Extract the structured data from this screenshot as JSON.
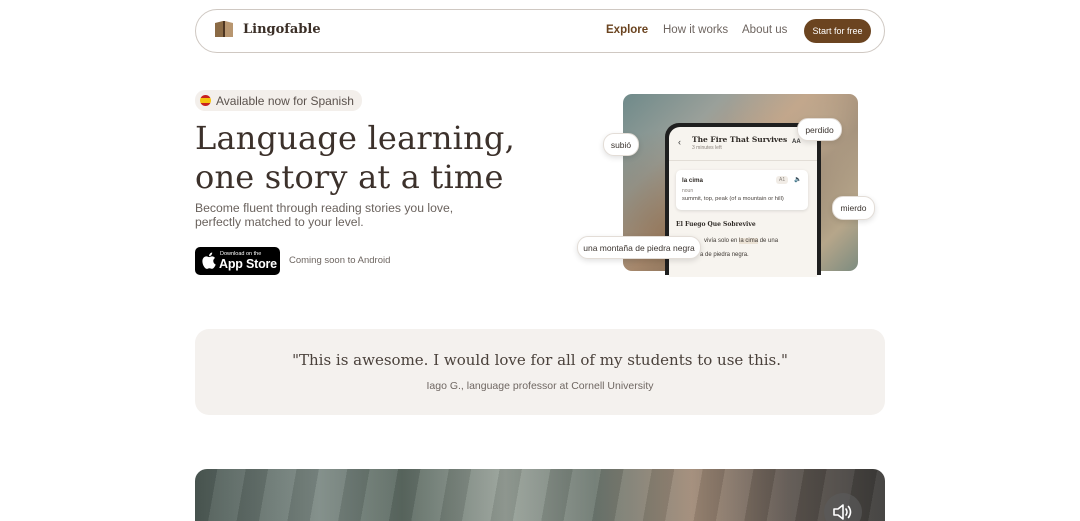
{
  "nav": {
    "brand": "Lingofable",
    "links": [
      "Explore",
      "How it works",
      "About us"
    ],
    "cta": "Start for free"
  },
  "hero": {
    "badge": "Available now for Spanish",
    "title_line1": "Language learning,",
    "title_line2": "one story at a time",
    "subtitle": "Become fluent through reading stories you love, perfectly matched to your level.",
    "appstore_small": "Download on the",
    "appstore_big": "App Store",
    "android_note": "Coming soon to Android"
  },
  "phone": {
    "story_title": "The Fire That Survives",
    "story_meta": "3 minutes left",
    "font_button": "AA",
    "word": "la cima",
    "word_pos": "noun",
    "word_def": "summit, top, peak (of a mountain or hill)",
    "word_level": "A1",
    "chapter": "El Fuego Que Sobrevive",
    "para_pre": "vivía solo en ",
    "para_hl": "la cima",
    "para_post": " de una",
    "para2": "a de piedra negra."
  },
  "bubbles": {
    "subio": "subió",
    "perdido": "perdido",
    "mierdo": "mierdo",
    "montana": "una montaña de piedra negra"
  },
  "testimonial": {
    "quote": "\"This is awesome. I would love for all of my students to use this.\"",
    "author": "Iago G., language professor at Cornell University"
  },
  "colors": {
    "brand_brown": "#6b4420",
    "quote_bg": "#f4f1ee"
  }
}
